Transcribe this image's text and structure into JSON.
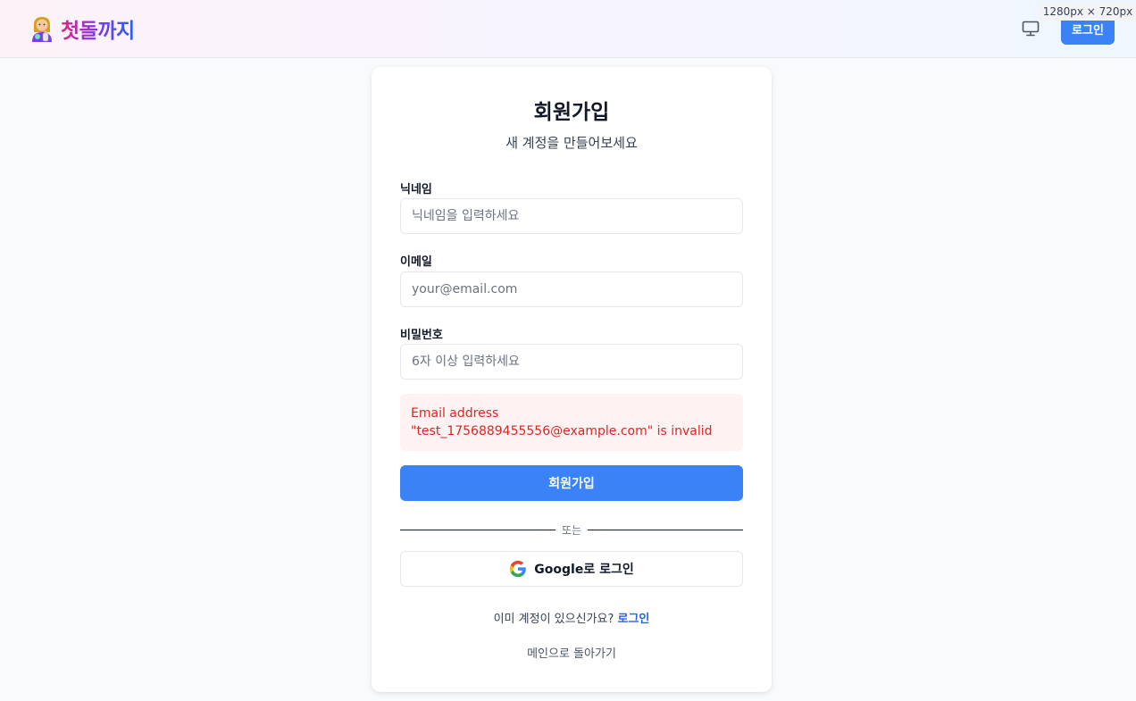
{
  "header": {
    "brand": "첫돌까지",
    "login_label": "로그인",
    "viewport_badge": "1280px × 720px",
    "icons": {
      "logo": "baby-bottle-person-icon",
      "display": "monitor-icon"
    }
  },
  "signup": {
    "title": "회원가입",
    "subtitle": "새 계정을 만들어보세요",
    "nickname": {
      "label": "닉네임",
      "placeholder": "닉네임을 입력하세요",
      "value": ""
    },
    "email": {
      "label": "이메일",
      "placeholder": "your@email.com",
      "value": ""
    },
    "password": {
      "label": "비밀번호",
      "placeholder": "6자 이상 입력하세요",
      "value": ""
    },
    "error": "Email address \"test_1756889455556@example.com\" is invalid",
    "submit_label": "회원가입",
    "divider_text": "또는",
    "google_label": "Google로 로그인",
    "has_account_text": "이미 계정이 있으신가요?",
    "login_link": "로그인",
    "back_link": "메인으로 돌아가기"
  },
  "colors": {
    "primary": "#3b82f6",
    "error_text": "#dc2626",
    "error_bg": "#fef2f2",
    "link": "#2563eb"
  }
}
